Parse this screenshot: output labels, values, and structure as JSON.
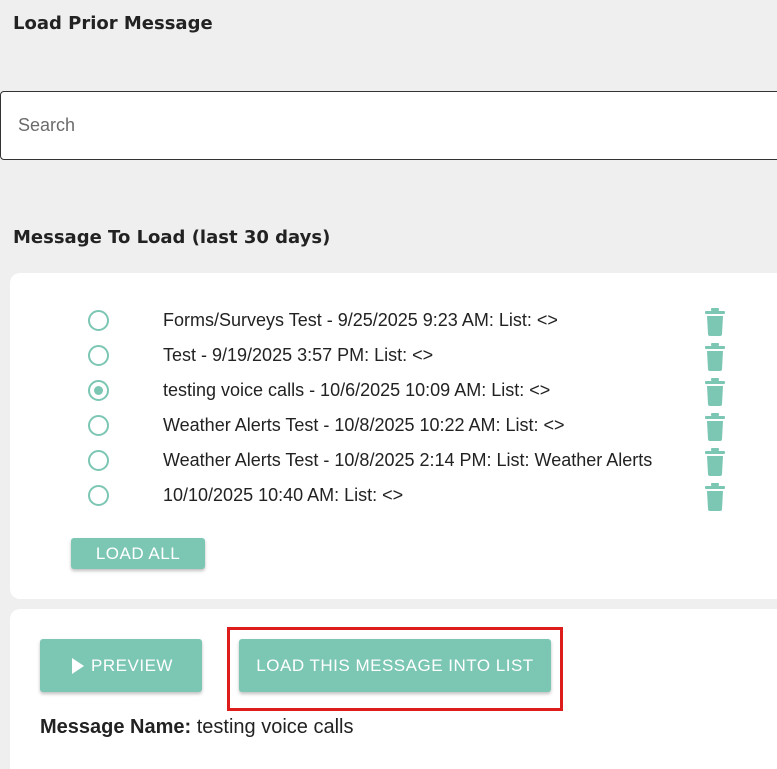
{
  "page": {
    "title": "Load Prior Message",
    "section_label": "Message To Load (last 30 days)"
  },
  "search": {
    "placeholder": "Search",
    "value": ""
  },
  "messages": [
    {
      "label": "Forms/Surveys Test - 9/25/2025 9:23 AM: List: <>",
      "selected": false
    },
    {
      "label": "Test - 9/19/2025 3:57 PM: List: <>",
      "selected": false
    },
    {
      "label": "testing voice calls - 10/6/2025 10:09 AM: List: <>",
      "selected": true
    },
    {
      "label": "Weather Alerts Test - 10/8/2025 10:22 AM: List: <>",
      "selected": false
    },
    {
      "label": "Weather Alerts Test - 10/8/2025 2:14 PM: List: Weather Alerts",
      "selected": false
    },
    {
      "label": "10/10/2025 10:40 AM: List: <>",
      "selected": false
    }
  ],
  "buttons": {
    "load_all": "LOAD ALL",
    "preview": "PREVIEW",
    "load_into_list": "LOAD THIS MESSAGE INTO LIST"
  },
  "details": {
    "name_label": "Message Name:",
    "name_value": "testing voice calls"
  },
  "colors": {
    "accent": "#7cc6b4",
    "highlight": "#dd1c1c",
    "background": "#efefef"
  },
  "icons": {
    "row_delete": "trash-icon",
    "preview": "play-icon"
  }
}
